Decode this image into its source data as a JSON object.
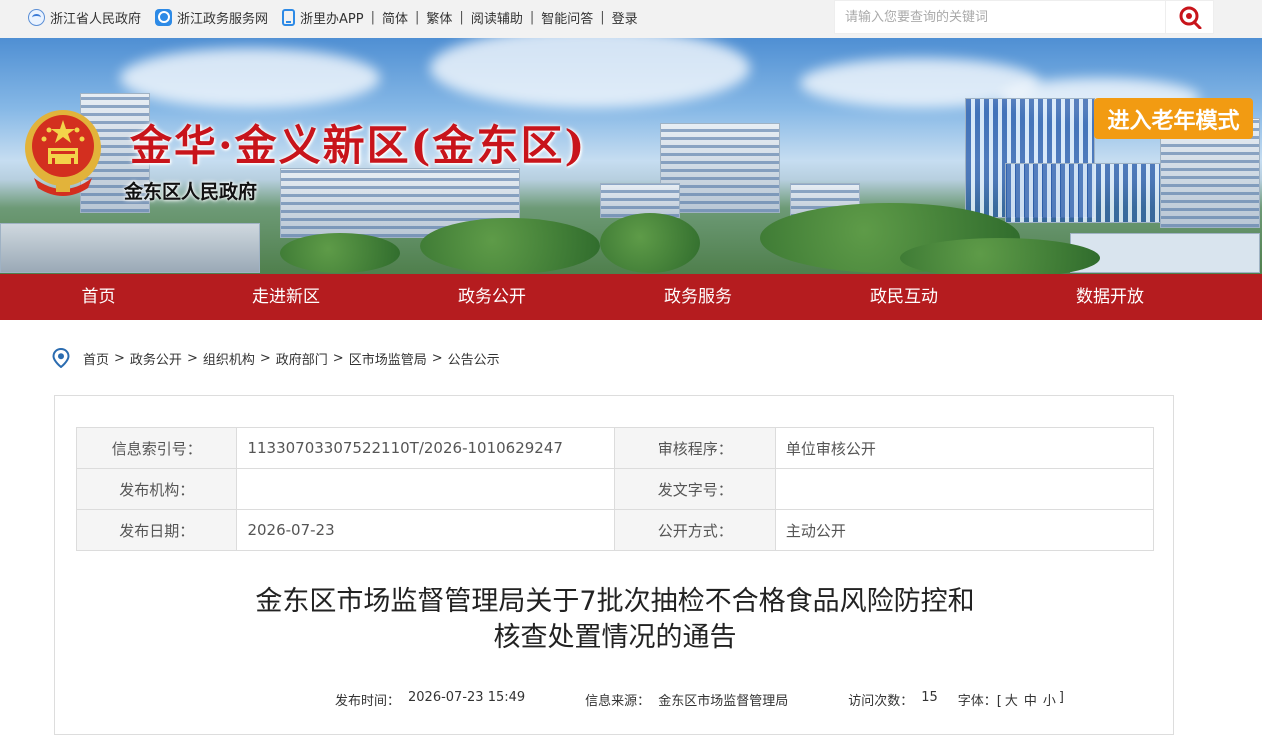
{
  "topbar": {
    "links": [
      "浙江省人民政府",
      "浙江政务服务网",
      "浙里办APP",
      "简体",
      "繁体",
      "阅读辅助",
      "智能问答",
      "登录"
    ],
    "search_placeholder": "请输入您要查询的关键词"
  },
  "banner": {
    "title": "金华·金义新区(金东区)",
    "subtitle": "金东区人民政府",
    "elder_mode": "进入老年模式"
  },
  "nav": {
    "items": [
      "首页",
      "走进新区",
      "政务公开",
      "政务服务",
      "政民互动",
      "数据开放"
    ]
  },
  "breadcrumb": [
    "首页",
    "政务公开",
    "组织机构",
    "政府部门",
    "区市场监管局",
    "公告公示"
  ],
  "meta": {
    "index_label": "信息索引号：",
    "index_value": "11330703307522110T/2026-1010629247",
    "review_label": "审核程序：",
    "review_value": "单位审核公开",
    "publisher_label": "发布机构：",
    "publisher_value": "",
    "docno_label": "发文字号：",
    "docno_value": "",
    "date_label": "发布日期：",
    "date_value": "2026-07-23",
    "mode_label": "公开方式：",
    "mode_value": "主动公开"
  },
  "article": {
    "title_line1": "金东区市场监督管理局关于7批次抽检不合格食品风险防控和",
    "title_line2": "核查处置情况的通告",
    "time_label": "发布时间：",
    "time_value": "2026-07-23 15:49",
    "source_label": "信息来源：",
    "source_value": "金东区市场监督管理局",
    "visits_label": "访问次数：",
    "visits_value": "15",
    "font_label": "字体：[",
    "font_large": "大",
    "font_medium": "中",
    "font_small": "小",
    "font_close": "]"
  },
  "colors": {
    "nav_red": "#b51c1f",
    "title_red": "#c8141b",
    "elder_orange": "#f29b12"
  }
}
